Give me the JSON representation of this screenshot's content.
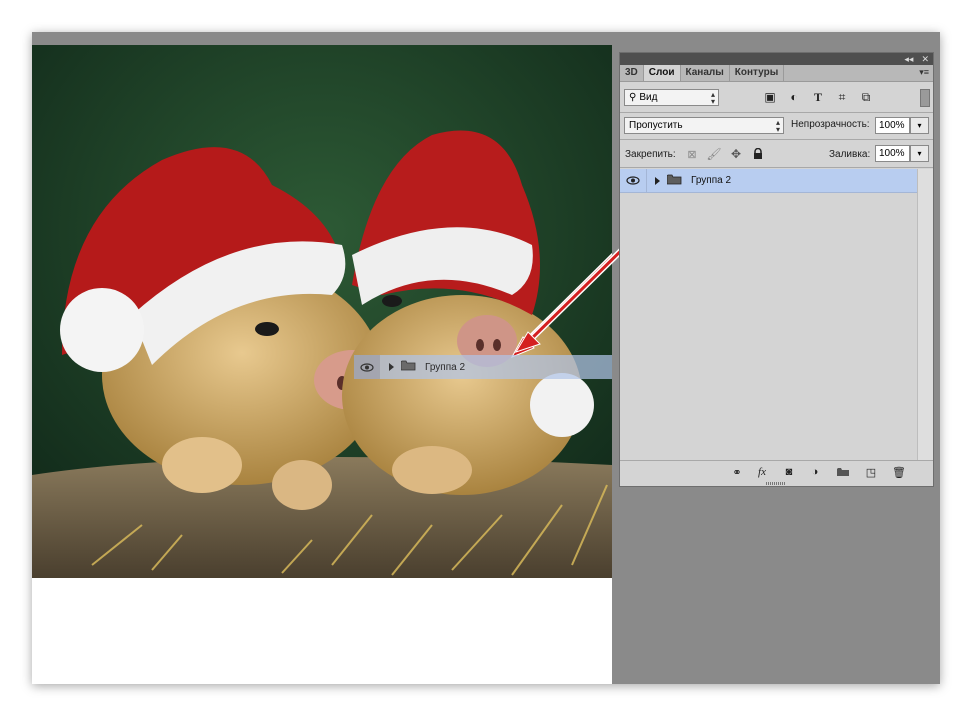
{
  "panel": {
    "tabs": [
      {
        "label": "3D"
      },
      {
        "label": "Слои"
      },
      {
        "label": "Каналы"
      },
      {
        "label": "Контуры"
      }
    ],
    "active_tab": "Слои",
    "filter": {
      "value": "Вид"
    },
    "blend_mode": {
      "value": "Пропустить"
    },
    "opacity": {
      "label": "Непрозрачность:",
      "value": "100%"
    },
    "lock": {
      "label": "Закрепить:"
    },
    "fill": {
      "label": "Заливка:",
      "value": "100%"
    },
    "layers": [
      {
        "name": "Группа 2",
        "visible": true,
        "type": "group",
        "selected": true
      }
    ]
  },
  "drag_ghost": {
    "label": "Группа 2"
  },
  "annotation": {
    "color": "#d42020"
  },
  "colors": {
    "selection": "#b8cdf0",
    "workspace": "#8a8a8a"
  }
}
